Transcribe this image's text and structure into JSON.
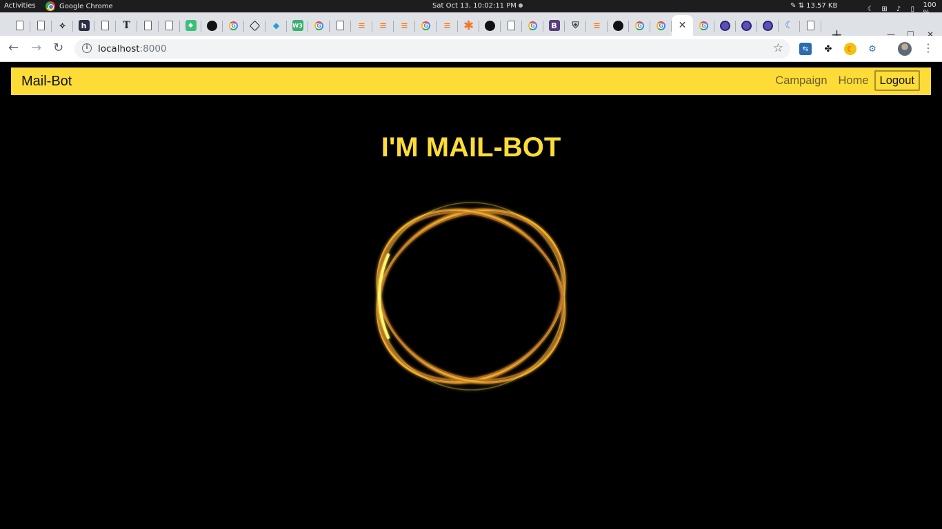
{
  "system_bar": {
    "activities": "Activities",
    "app_name": "Google Chrome",
    "clock": "Sat Oct 13, 10:02:11 PM",
    "net_speed": "⇅ 13.57 KB",
    "battery": "100 %"
  },
  "browser": {
    "url_host": "localhost",
    "url_port": ":8000",
    "tabs": [
      {
        "icon": "page-icon"
      },
      {
        "icon": "page-icon"
      },
      {
        "icon": "leaf-icon"
      },
      {
        "icon": "hashnode-icon"
      },
      {
        "icon": "page-icon"
      },
      {
        "icon": "typography-icon"
      },
      {
        "icon": "page-icon"
      },
      {
        "icon": "page-icon"
      },
      {
        "icon": "green-app-icon"
      },
      {
        "icon": "github-icon"
      },
      {
        "icon": "google-icon"
      },
      {
        "icon": "codepen-icon"
      },
      {
        "icon": "code-icon"
      },
      {
        "icon": "w3c-icon"
      },
      {
        "icon": "google-icon"
      },
      {
        "icon": "page-icon"
      },
      {
        "icon": "stackoverflow-icon"
      },
      {
        "icon": "stackoverflow-icon"
      },
      {
        "icon": "stackoverflow-icon"
      },
      {
        "icon": "google-icon"
      },
      {
        "icon": "stackoverflow-icon"
      },
      {
        "icon": "asterisk-icon"
      },
      {
        "icon": "github-icon"
      },
      {
        "icon": "page-icon"
      },
      {
        "icon": "google-icon"
      },
      {
        "icon": "bootstrap-icon"
      },
      {
        "icon": "shield-icon"
      },
      {
        "icon": "stackoverflow-icon"
      },
      {
        "icon": "github-icon"
      },
      {
        "icon": "google-icon"
      },
      {
        "icon": "google-icon"
      },
      {
        "icon": "close-icon",
        "active": true
      },
      {
        "icon": "google-icon"
      },
      {
        "icon": "circle-app-icon"
      },
      {
        "icon": "circle-app-icon"
      },
      {
        "icon": "circle-app-icon"
      },
      {
        "icon": "spiral-icon"
      },
      {
        "icon": "page-icon"
      }
    ]
  },
  "navbar": {
    "brand": "Mail-Bot",
    "links": {
      "campaign": "Campaign",
      "home": "Home",
      "logout": "Logout"
    }
  },
  "hero": {
    "title": "I'M MAIL-BOT"
  },
  "colors": {
    "accent": "#fddc38",
    "background": "#000000",
    "ring_gold": "#f5b21f",
    "ring_bronze": "#b8732d"
  }
}
